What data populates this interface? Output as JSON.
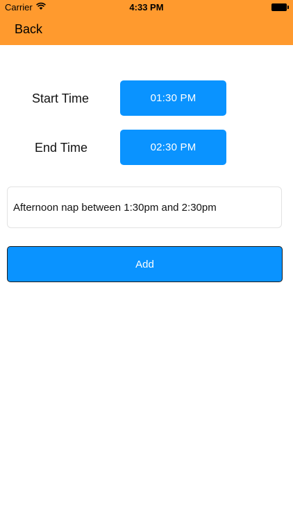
{
  "status_bar": {
    "carrier": "Carrier",
    "time": "4:33 PM"
  },
  "nav": {
    "back_label": "Back"
  },
  "form": {
    "start_label": "Start Time",
    "start_value": "01:30 PM",
    "end_label": "End Time",
    "end_value": "02:30 PM",
    "note_text": "Afternoon nap between 1:30pm and 2:30pm",
    "add_label": "Add"
  },
  "colors": {
    "nav_bar": "#ff9a2e",
    "button_blue": "#0a93ff"
  }
}
